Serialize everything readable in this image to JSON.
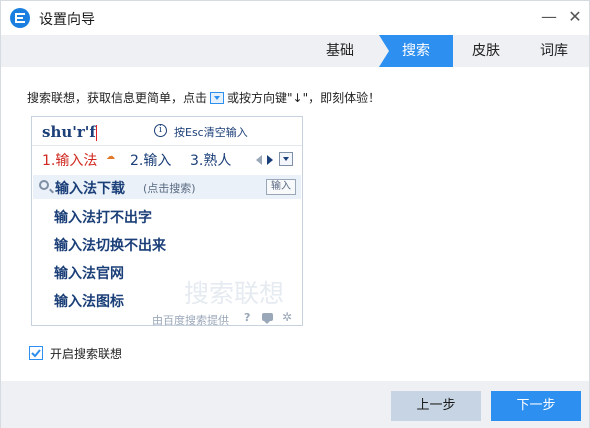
{
  "window": {
    "title": "设置向导",
    "minimize_glyph": "—",
    "close_glyph": "✕"
  },
  "steps": [
    {
      "label": "基础",
      "active": false
    },
    {
      "label": "搜索",
      "active": true
    },
    {
      "label": "皮肤",
      "active": false
    },
    {
      "label": "词库",
      "active": false
    }
  ],
  "hint": {
    "before": "搜索联想，获取信息更简单，点击",
    "after": "或按方向键\"↓\"，即刻体验！"
  },
  "ime": {
    "composition": "shu'r'f",
    "info_glyph": "i",
    "esc_hint": "按Esc清空输入",
    "candidates": [
      "1.输入法",
      "2.输入",
      "3.熟人"
    ],
    "search_main": "输入法下载",
    "search_sub": "(点击搜索)",
    "enter_key": "输入",
    "suggestions": [
      "输入法打不出字",
      "输入法切换不出来",
      "输入法官网",
      "输入法图标"
    ],
    "watermark": "搜索联想",
    "provider": "由百度搜索提供",
    "help_glyph": "?",
    "gear_glyph": "✲"
  },
  "option": {
    "label": "开启搜索联想",
    "checked": true
  },
  "buttons": {
    "prev": "上一步",
    "next": "下一步"
  },
  "colors": {
    "accent": "#2d8ff0",
    "candidate_first": "#d0281f",
    "candidate_text": "#1b3f78"
  }
}
